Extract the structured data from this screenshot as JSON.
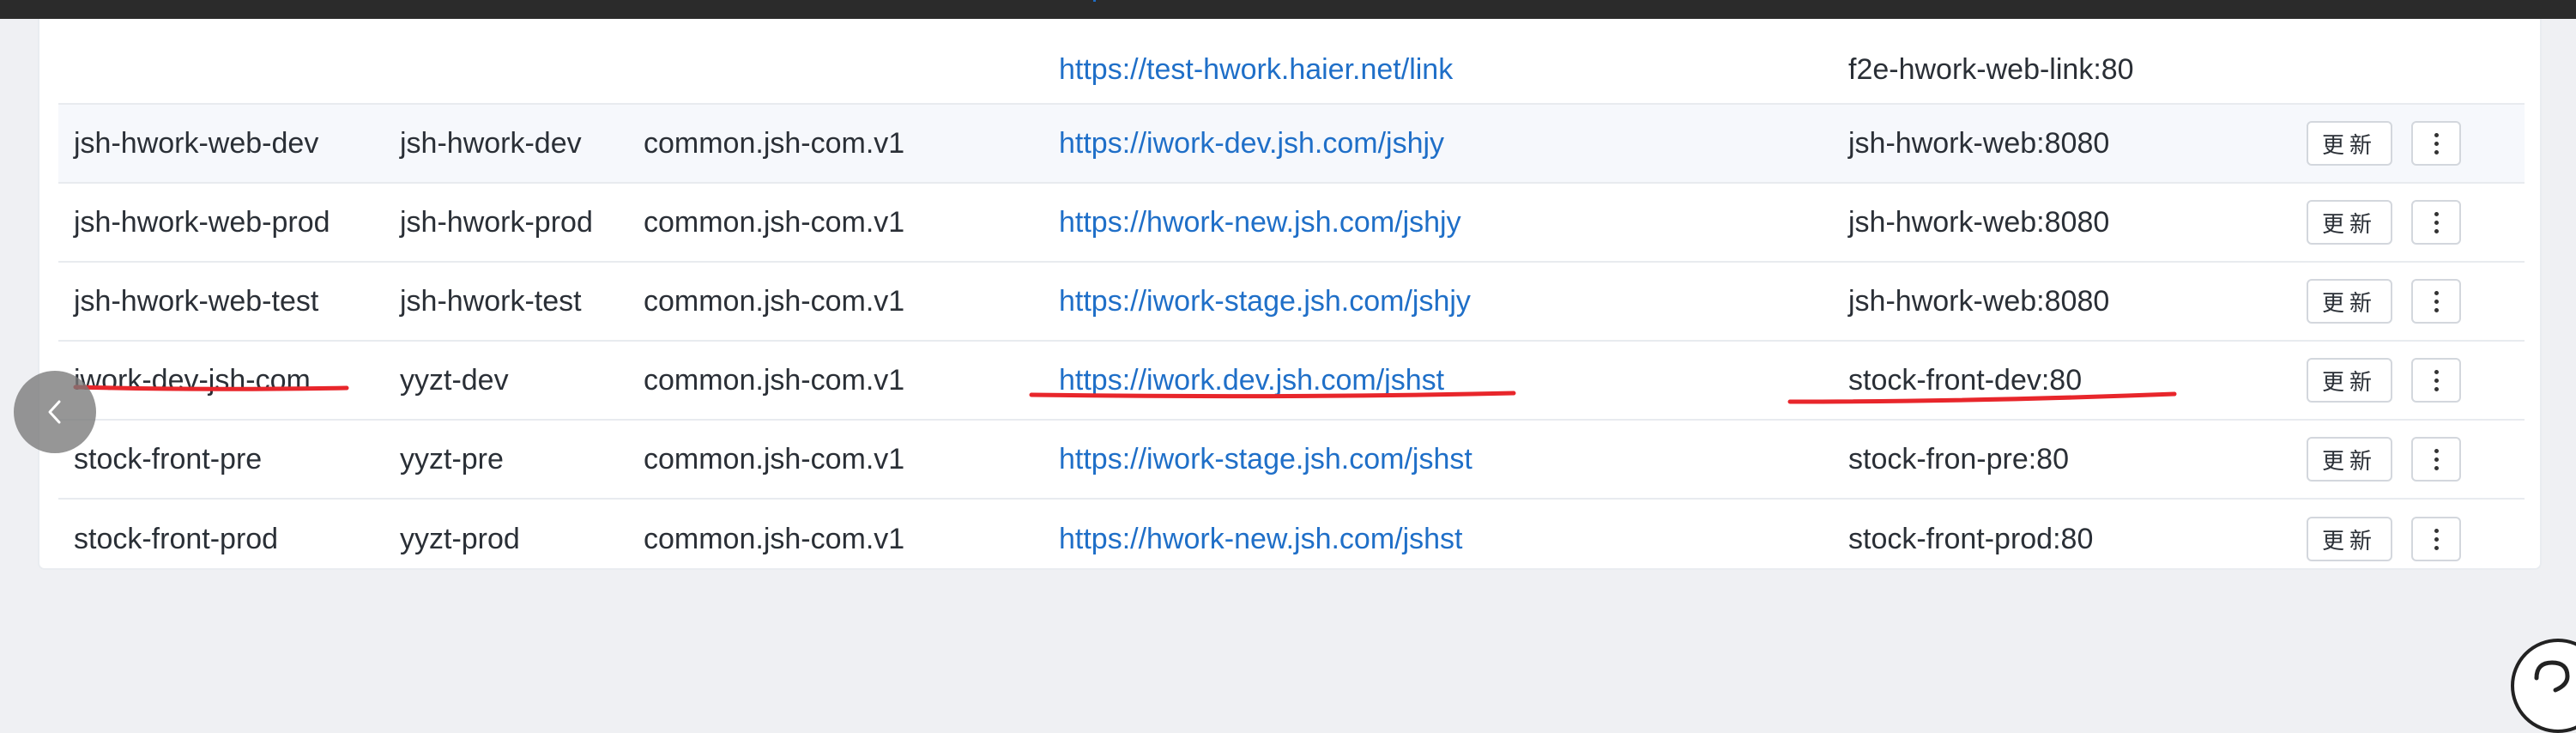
{
  "partial_row": {
    "url": "https://test-hwork.haier.net/link",
    "service": "f2e-hwork-web-link:80"
  },
  "rows": [
    {
      "name": "jsh-hwork-web-dev",
      "namespace": "jsh-hwork-dev",
      "gateway": "common.jsh-com.v1",
      "url": "https://iwork-dev.jsh.com/jshjy",
      "service": "jsh-hwork-web:8080",
      "update_label": "更新"
    },
    {
      "name": "jsh-hwork-web-prod",
      "namespace": "jsh-hwork-prod",
      "gateway": "common.jsh-com.v1",
      "url": "https://hwork-new.jsh.com/jshjy",
      "service": "jsh-hwork-web:8080",
      "update_label": "更新"
    },
    {
      "name": "jsh-hwork-web-test",
      "namespace": "jsh-hwork-test",
      "gateway": "common.jsh-com.v1",
      "url": "https://iwork-stage.jsh.com/jshjy",
      "service": "jsh-hwork-web:8080",
      "update_label": "更新"
    },
    {
      "name": "iwork-dev-jsh-com",
      "namespace": "yyzt-dev",
      "gateway": "common.jsh-com.v1",
      "url": "https://iwork.dev.jsh.com/jshst",
      "service": "stock-front-dev:80",
      "update_label": "更新"
    },
    {
      "name": "stock-front-pre",
      "namespace": "yyzt-pre",
      "gateway": "common.jsh-com.v1",
      "url": "https://iwork-stage.jsh.com/jshst",
      "service": "stock-fron-pre:80",
      "update_label": "更新"
    },
    {
      "name": "stock-front-prod",
      "namespace": "yyzt-prod",
      "gateway": "common.jsh-com.v1",
      "url": "https://hwork-new.jsh.com/jshst",
      "service": "stock-front-prod:80",
      "update_label": "更新"
    }
  ],
  "colors": {
    "link": "#1f6fc8",
    "annotation": "#e8262b",
    "page_bg": "#eff0f3"
  },
  "icons": {
    "back": "chevron-left-icon",
    "more": "more-vertical-icon",
    "help": "help-icon"
  }
}
